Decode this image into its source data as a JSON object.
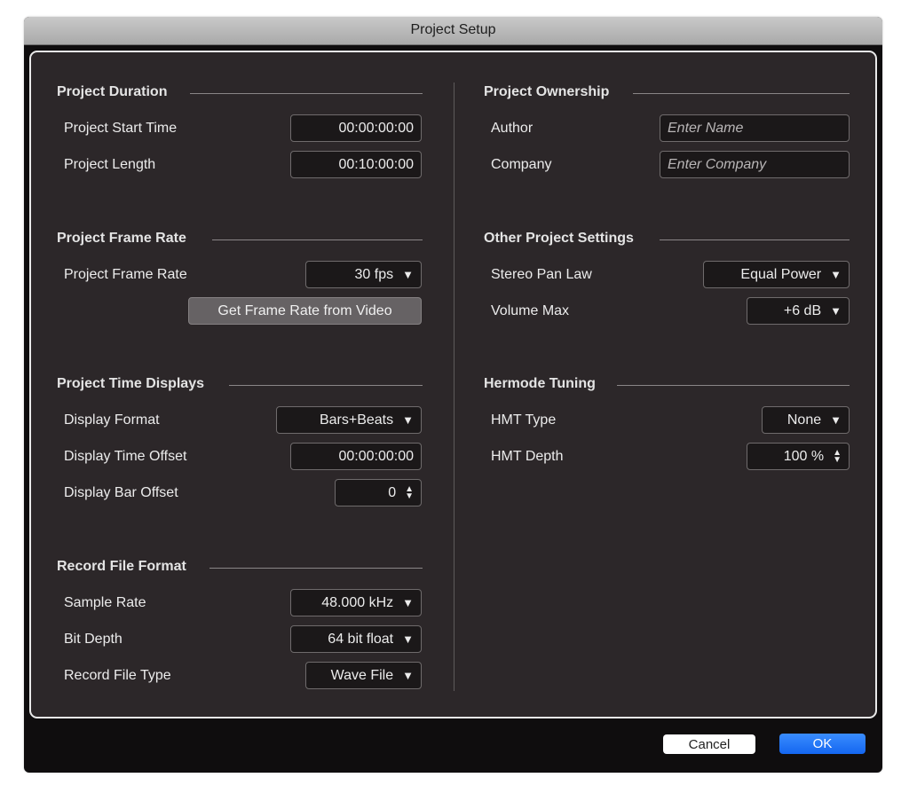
{
  "window": {
    "title": "Project Setup"
  },
  "sections": {
    "duration": {
      "title": "Project Duration",
      "start_time": {
        "label": "Project Start Time",
        "value": "00:00:00:00"
      },
      "length": {
        "label": "Project Length",
        "value": "00:10:00:00"
      }
    },
    "frame_rate": {
      "title": "Project Frame Rate",
      "rate": {
        "label": "Project Frame Rate",
        "value": "30 fps"
      },
      "get_from_video_label": "Get Frame Rate from Video"
    },
    "time_displays": {
      "title": "Project Time Displays",
      "format": {
        "label": "Display Format",
        "value": "Bars+Beats"
      },
      "time_offset": {
        "label": "Display Time Offset",
        "value": "00:00:00:00"
      },
      "bar_offset": {
        "label": "Display Bar Offset",
        "value": "0"
      }
    },
    "record_format": {
      "title": "Record File Format",
      "sample_rate": {
        "label": "Sample Rate",
        "value": "48.000 kHz"
      },
      "bit_depth": {
        "label": "Bit Depth",
        "value": "64 bit float"
      },
      "file_type": {
        "label": "Record File Type",
        "value": "Wave File"
      }
    },
    "ownership": {
      "title": "Project Ownership",
      "author": {
        "label": "Author",
        "value": "",
        "placeholder": "Enter Name"
      },
      "company": {
        "label": "Company",
        "value": "",
        "placeholder": "Enter Company"
      }
    },
    "other": {
      "title": "Other Project Settings",
      "pan_law": {
        "label": "Stereo Pan Law",
        "value": "Equal Power"
      },
      "volume_max": {
        "label": "Volume Max",
        "value": "+6 dB"
      }
    },
    "hermode": {
      "title": "Hermode Tuning",
      "hmt_type": {
        "label": "HMT Type",
        "value": "None"
      },
      "hmt_depth": {
        "label": "HMT Depth",
        "value": "100 %"
      }
    }
  },
  "icons": {
    "dropdown": "▼",
    "step_up": "▲",
    "step_down": "▼"
  },
  "footer": {
    "cancel_label": "Cancel",
    "ok_label": "OK"
  },
  "colors": {
    "accent": "#1a6ef5",
    "panel_bg": "#2c2729",
    "window_bg": "#0f0d0e"
  }
}
